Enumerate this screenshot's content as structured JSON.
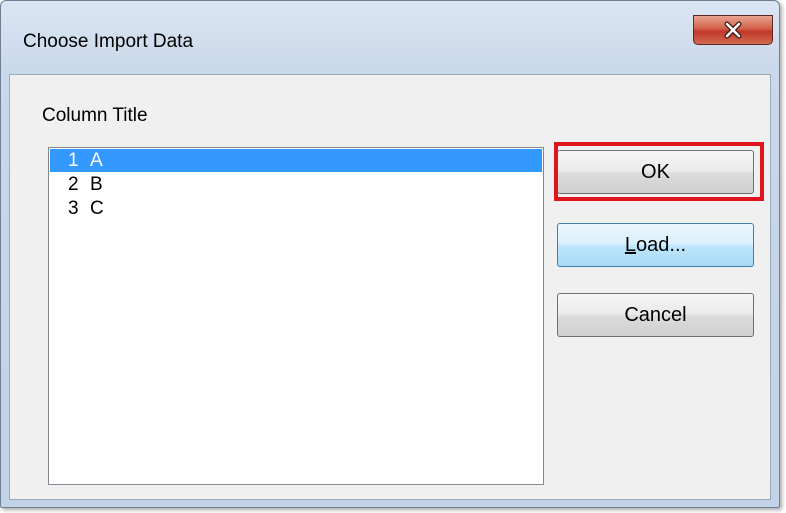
{
  "window": {
    "title": "Choose Import Data"
  },
  "dialog": {
    "column_title_label": "Column Title",
    "list_items": [
      {
        "num": "1",
        "name": "A",
        "selected": true
      },
      {
        "num": "2",
        "name": "B",
        "selected": false
      },
      {
        "num": "3",
        "name": "C",
        "selected": false
      }
    ],
    "buttons": {
      "ok_label": "OK",
      "load_label_first": "L",
      "load_label_rest": "oad...",
      "cancel_label": "Cancel"
    }
  },
  "icons": {
    "close": "close-icon"
  },
  "colors": {
    "selection": "#3399ff",
    "highlight_annotation": "#e0141e",
    "close_button": "#c0382a"
  }
}
